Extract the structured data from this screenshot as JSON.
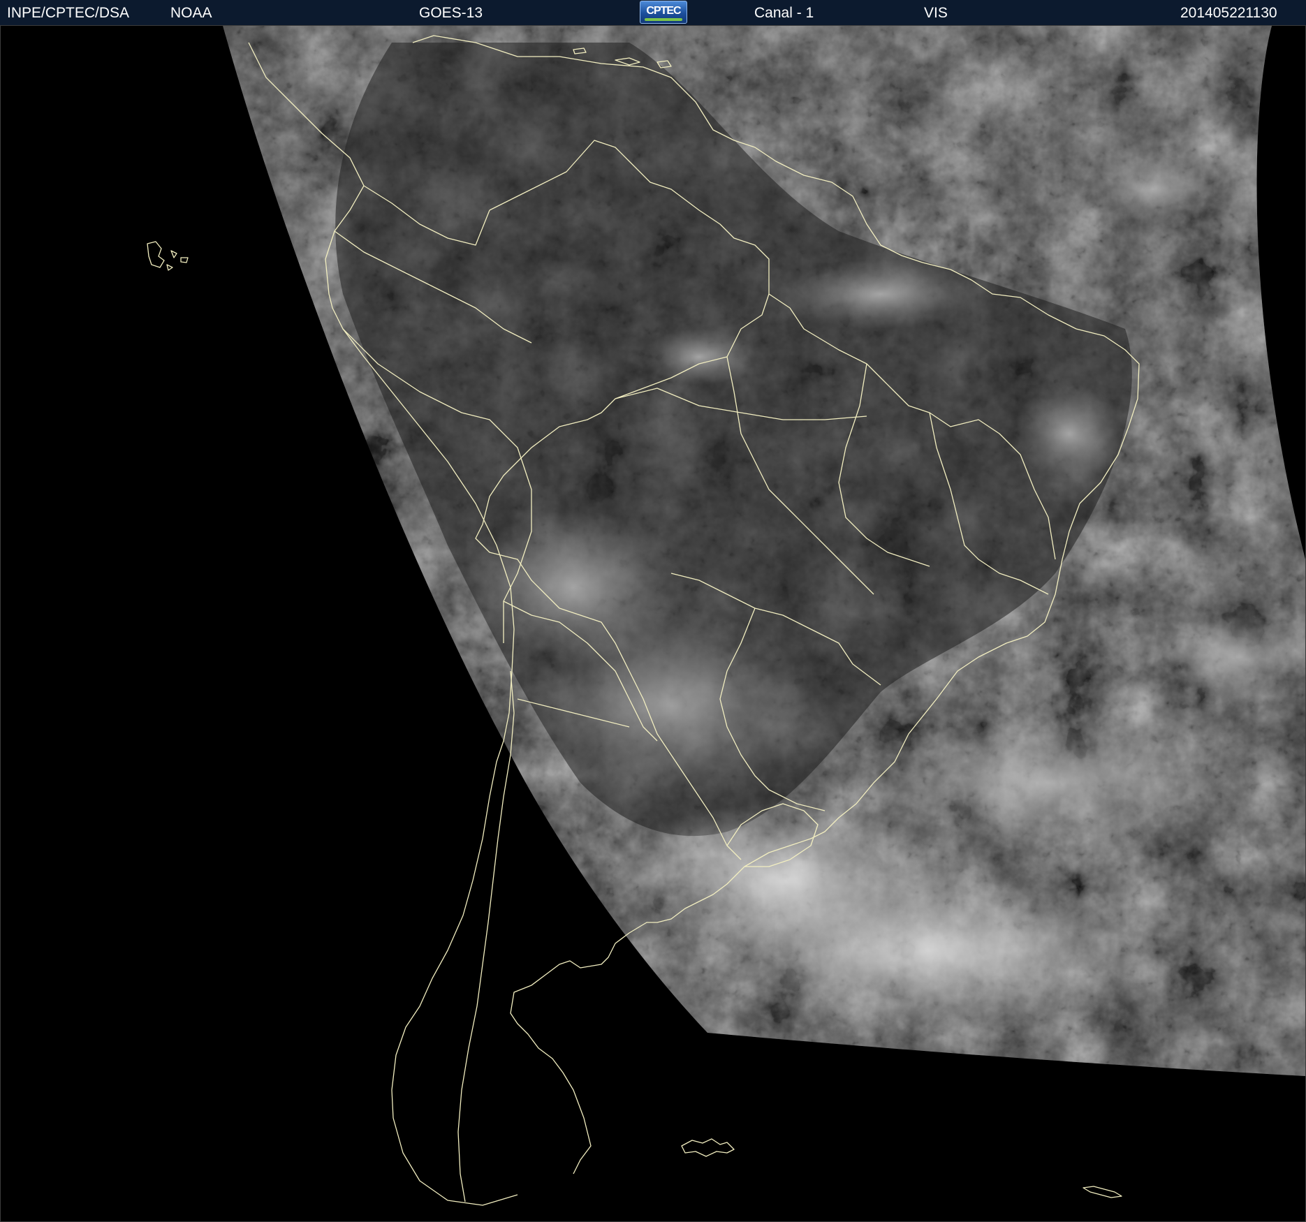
{
  "header": {
    "organization": "INPE/CPTEC/DSA",
    "agency": "NOAA",
    "satellite": "GOES-13",
    "logo_text": "CPTEC",
    "channel": "Canal - 1",
    "band": "VIS",
    "timestamp": "201405221130"
  },
  "imagery": {
    "kind": "visible-channel satellite image, grayscale",
    "colors": {
      "space": "#000000",
      "ocean": "#3a3a3a",
      "land": "#2a2a2a",
      "cloud": "#d8d8d8",
      "boundaries": "#f2eec0",
      "header_bg": "#0c1a2e"
    }
  }
}
